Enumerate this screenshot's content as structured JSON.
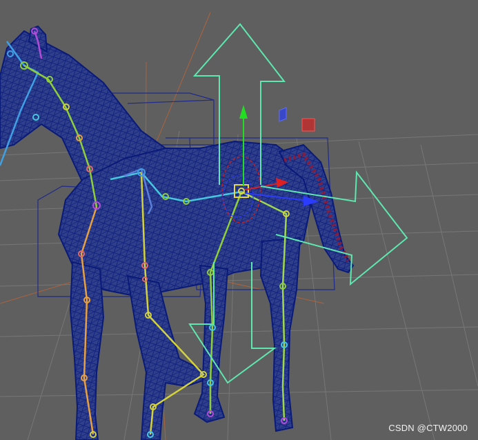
{
  "viewport": {
    "background_color": "#5f5f5f",
    "grid_color": "#7a7a7a",
    "mesh_color": "#0a1a78",
    "manipulator_color": "#5ee8b0",
    "axis_y_color": "#22dd22",
    "axis_x_color": "#e02020",
    "axis_z_color": "#2b3cff",
    "ik_handle_color": "#e8d840",
    "bone_colors": [
      "#3fa0e6",
      "#8fcf3a",
      "#d4d23c",
      "#b44bd8",
      "#e06a6a",
      "#45c8e0",
      "#e8a040"
    ],
    "icons": [
      "move-manipulator-arrow-up-icon",
      "move-manipulator-arrow-right-icon",
      "move-manipulator-arrow-down-icon",
      "joint-pivot-icon"
    ]
  },
  "watermark": "CSDN @CTW2000"
}
